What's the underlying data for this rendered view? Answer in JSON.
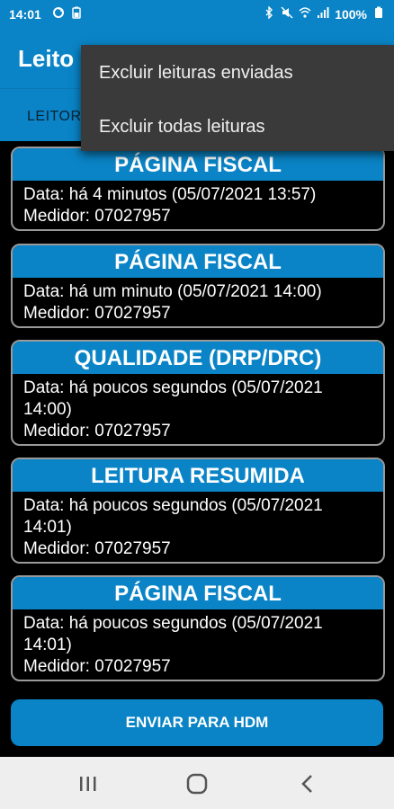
{
  "status_bar": {
    "time": "14:01",
    "battery": "100%",
    "left_icons": [
      "sync-icon",
      "battery-saver-icon"
    ],
    "right_icons": [
      "bluetooth-icon",
      "mute-icon",
      "wifi-icon",
      "signal-icon"
    ]
  },
  "app_bar": {
    "title": "Leito"
  },
  "tabs": {
    "active_label": "LEITOR"
  },
  "overflow_menu": {
    "items": [
      "Excluir leituras enviadas",
      "Excluir todas leituras"
    ]
  },
  "cards": [
    {
      "title": "PÁGINA FISCAL",
      "lines": [
        "Data: há 4 minutos (05/07/2021 13:57)",
        "Medidor: 07027957"
      ]
    },
    {
      "title": "PÁGINA FISCAL",
      "lines": [
        "Data: há um minuto (05/07/2021 14:00)",
        "Medidor: 07027957"
      ]
    },
    {
      "title": "QUALIDADE (DRP/DRC)",
      "lines": [
        "Data: há poucos segundos (05/07/2021",
        "14:00)",
        "Medidor: 07027957"
      ]
    },
    {
      "title": "LEITURA RESUMIDA",
      "lines": [
        "Data: há poucos segundos (05/07/2021",
        "14:01)",
        "Medidor: 07027957"
      ]
    },
    {
      "title": "PÁGINA FISCAL",
      "lines": [
        "Data: há poucos segundos (05/07/2021",
        "14:01)",
        "Medidor: 07027957"
      ]
    }
  ],
  "send_button": {
    "label": "ENVIAR PARA HDM"
  },
  "nav_bar": {
    "buttons": [
      "recents-icon",
      "home-icon",
      "back-icon"
    ]
  },
  "colors": {
    "accent": "#0a84c6",
    "menu_bg": "#3a3a3a",
    "card_border": "#9a9a9a",
    "background": "#000000"
  }
}
